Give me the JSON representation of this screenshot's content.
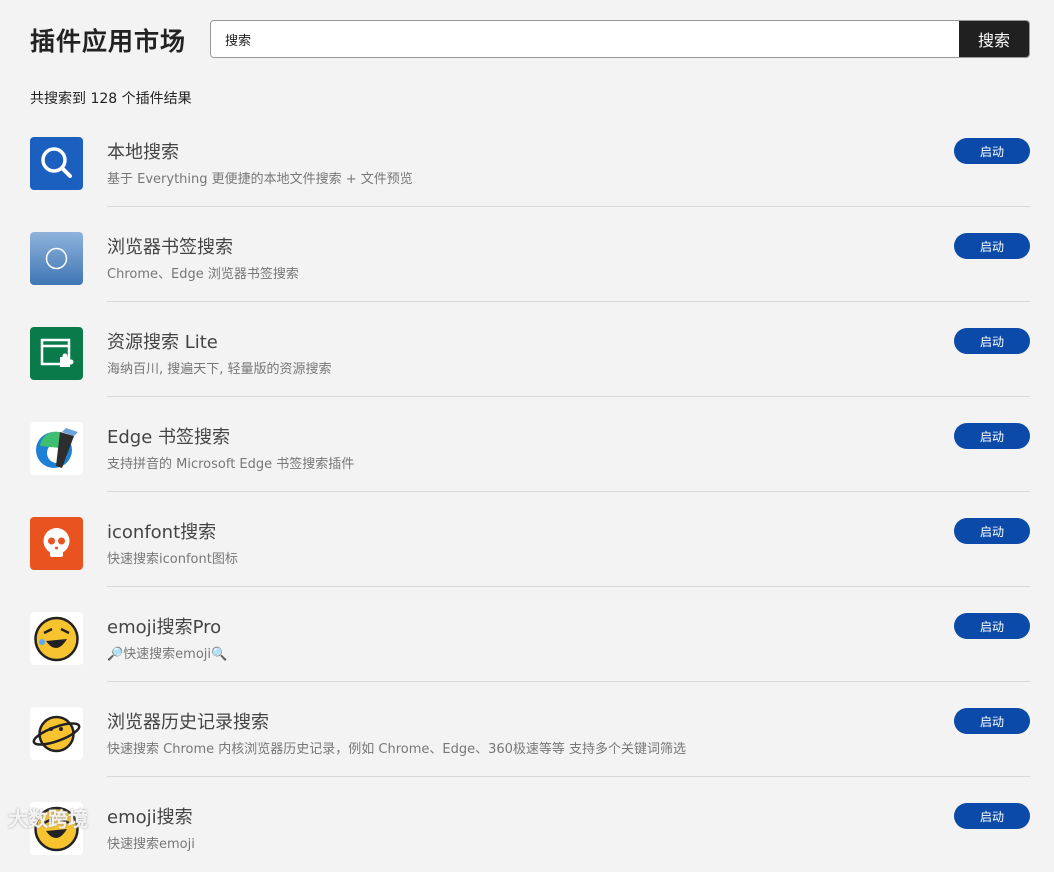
{
  "header": {
    "title": "插件应用市场",
    "search_value": "搜索",
    "search_button": "搜索"
  },
  "result_count": "共搜索到 128 个插件结果",
  "items": [
    {
      "name": "本地搜索",
      "desc": "基于 Everything 更便捷的本地文件搜索 + 文件预览",
      "button": "启动",
      "icon": "magnifier-icon"
    },
    {
      "name": "浏览器书签搜索",
      "desc": "Chrome、Edge 浏览器书签搜索",
      "button": "启动",
      "icon": "circle-icon"
    },
    {
      "name": "资源搜索 Lite",
      "desc": "海纳百川, 搜遍天下, 轻量版的资源搜索",
      "button": "启动",
      "icon": "window-puzzle-icon"
    },
    {
      "name": "Edge 书签搜索",
      "desc": "支持拼音的 Microsoft Edge 书签搜索插件",
      "button": "启动",
      "icon": "edge-icon"
    },
    {
      "name": "iconfont搜索",
      "desc": "快速搜索iconfont图标",
      "button": "启动",
      "icon": "skull-icon"
    },
    {
      "name": "emoji搜索Pro",
      "desc": "🔎快速搜索emoji🔍",
      "button": "启动",
      "icon": "laughing-emoji-icon"
    },
    {
      "name": "浏览器历史记录搜索",
      "desc": "快速搜索 Chrome 内核浏览器历史记录，例如 Chrome、Edge、360极速等等 支持多个关键词筛选",
      "button": "启动",
      "icon": "planet-emoji-icon"
    },
    {
      "name": "emoji搜索",
      "desc": "快速搜索emoji",
      "button": "启动",
      "icon": "laughing-emoji-icon"
    }
  ],
  "watermark": "大数跨境"
}
